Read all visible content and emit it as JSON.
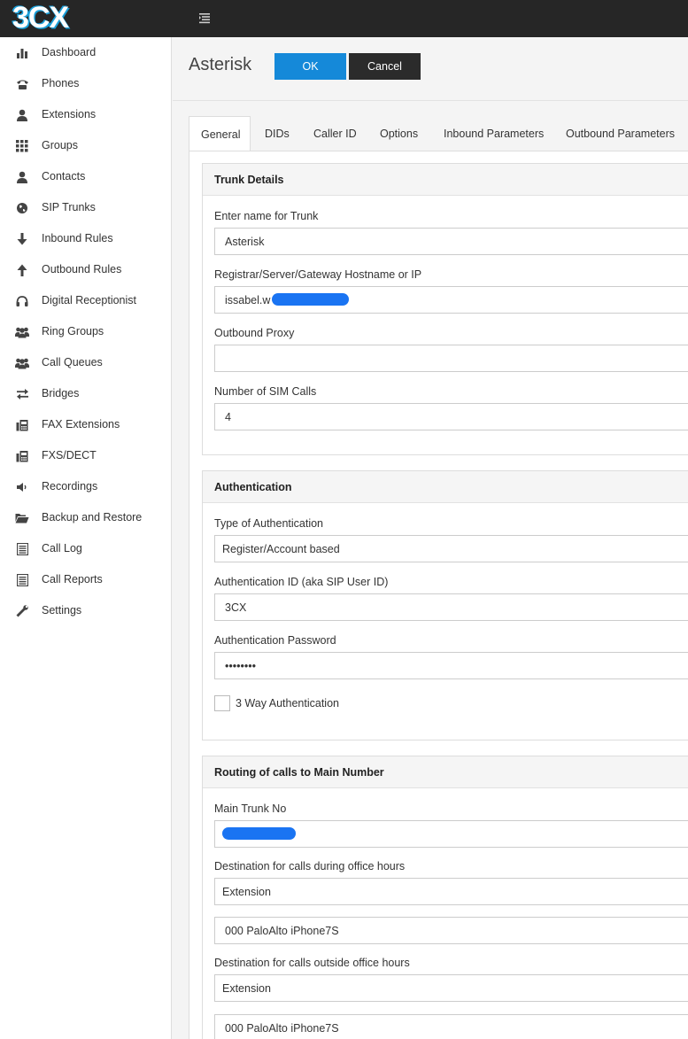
{
  "app": {
    "logo_text": "3CX",
    "brand_color": "#1a9fd9"
  },
  "sidebar": {
    "items": [
      {
        "label": "Dashboard",
        "icon": "bar-chart-icon"
      },
      {
        "label": "Phones",
        "icon": "phone-icon"
      },
      {
        "label": "Extensions",
        "icon": "user-icon"
      },
      {
        "label": "Groups",
        "icon": "grid-icon"
      },
      {
        "label": "Contacts",
        "icon": "user-icon"
      },
      {
        "label": "SIP Trunks",
        "icon": "globe-icon"
      },
      {
        "label": "Inbound Rules",
        "icon": "arrow-down-icon"
      },
      {
        "label": "Outbound Rules",
        "icon": "arrow-up-icon"
      },
      {
        "label": "Digital Receptionist",
        "icon": "headphones-icon"
      },
      {
        "label": "Ring Groups",
        "icon": "users-icon"
      },
      {
        "label": "Call Queues",
        "icon": "users-icon"
      },
      {
        "label": "Bridges",
        "icon": "exchange-icon"
      },
      {
        "label": "FAX Extensions",
        "icon": "fax-icon"
      },
      {
        "label": "FXS/DECT",
        "icon": "fax-icon"
      },
      {
        "label": "Recordings",
        "icon": "volume-icon"
      },
      {
        "label": "Backup and Restore",
        "icon": "folder-open-icon"
      },
      {
        "label": "Call Log",
        "icon": "list-icon"
      },
      {
        "label": "Call Reports",
        "icon": "list-icon"
      },
      {
        "label": "Settings",
        "icon": "wrench-icon"
      }
    ]
  },
  "header": {
    "title": "Asterisk",
    "ok_label": "OK",
    "cancel_label": "Cancel",
    "ok_color": "#1589d9",
    "cancel_color": "#2b2b2b"
  },
  "tabs": [
    {
      "label": "General",
      "active": true
    },
    {
      "label": "DIDs"
    },
    {
      "label": "Caller ID"
    },
    {
      "label": "Options"
    },
    {
      "label": "Inbound Parameters"
    },
    {
      "label": "Outbound Parameters"
    }
  ],
  "trunk_details": {
    "heading": "Trunk Details",
    "name_label": "Enter name for Trunk",
    "name_value": "Asterisk",
    "host_label": "Registrar/Server/Gateway Hostname or IP",
    "host_value": "issabel.w",
    "proxy_label": "Outbound Proxy",
    "proxy_value": "",
    "sim_label": "Number of SIM Calls",
    "sim_value": "4"
  },
  "authentication": {
    "heading": "Authentication",
    "type_label": "Type of Authentication",
    "type_value": "Register/Account based",
    "id_label": "Authentication ID (aka SIP User ID)",
    "id_value": "3CX",
    "password_label": "Authentication Password",
    "password_value": "••••••••",
    "three_way_label": "3 Way Authentication",
    "three_way_checked": false
  },
  "routing": {
    "heading": "Routing of calls to Main Number",
    "main_trunk_label": "Main Trunk No",
    "main_trunk_value": "",
    "office_hours_label": "Destination for calls during office hours",
    "office_hours_type": "Extension",
    "office_hours_target": "000 PaloAlto iPhone7S",
    "outside_hours_label": "Destination for calls outside office hours",
    "outside_hours_type": "Extension",
    "outside_hours_target": "000 PaloAlto iPhone7S"
  }
}
